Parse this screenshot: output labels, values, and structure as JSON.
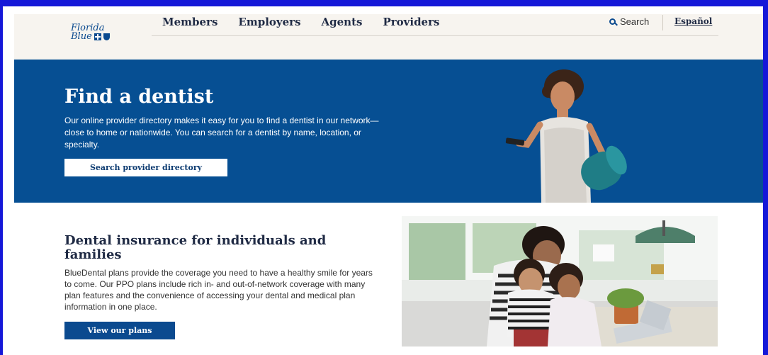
{
  "header": {
    "logo_line1": "Florida",
    "logo_line2": "Blue",
    "nav": [
      "Members",
      "Employers",
      "Agents",
      "Providers"
    ],
    "search_label": "Search",
    "language_link": "Español"
  },
  "hero": {
    "title": "Find a dentist",
    "description": "Our online provider directory makes it easy for you to find a dentist in our network—close to home or nationwide. You can search for a dentist by name, location, or specialty.",
    "button_label": "Search provider directory"
  },
  "section": {
    "title": "Dental insurance for individuals and families",
    "description": "BlueDental plans provide the coverage you need to have a healthy smile for years to come. Our PPO plans include rich in- and out-of-network coverage with many plan features and the convenience of accessing your dental and medical plan information in one place.",
    "button_label": "View our plans"
  },
  "colors": {
    "page_border": "#1518d8",
    "header_bg": "#f7f4ef",
    "hero_bg": "#064f93",
    "brand_blue": "#0b4a8f",
    "heading_text": "#1f2a44"
  },
  "icons": {
    "search": "search-icon",
    "logo_cross": "cross-icon",
    "logo_shield": "shield-icon"
  }
}
